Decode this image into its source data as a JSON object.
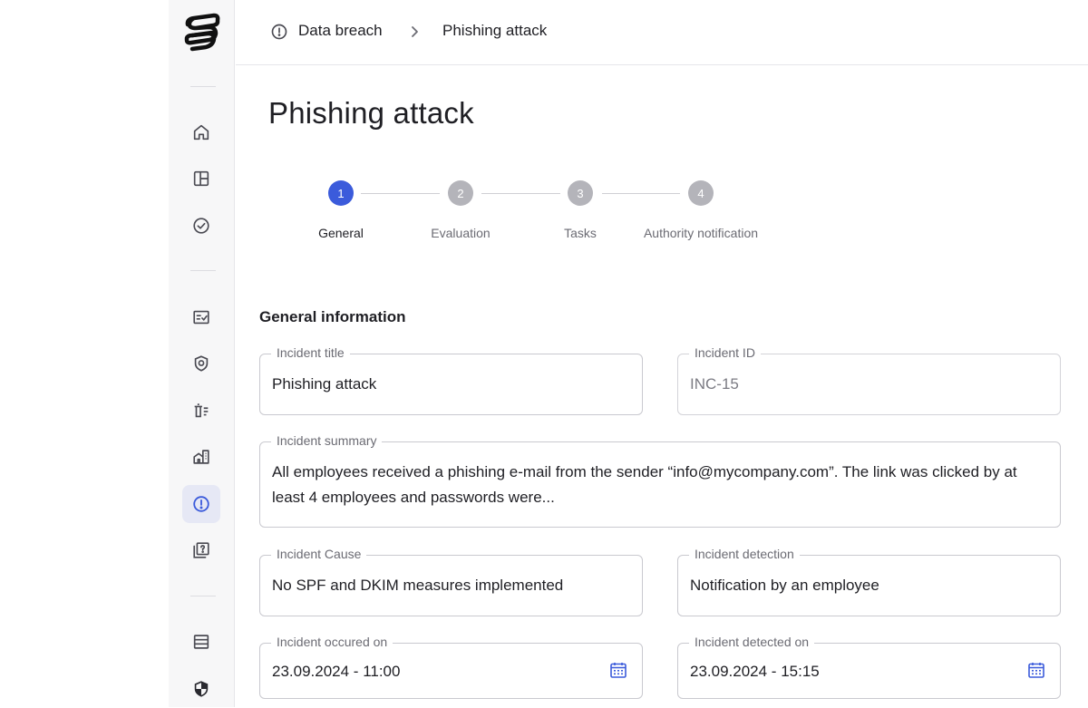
{
  "breadcrumb": {
    "items": [
      {
        "label": "Data breach",
        "icon": "alert-circle-icon"
      },
      {
        "label": "Phishing attack"
      }
    ]
  },
  "page": {
    "title": "Phishing attack"
  },
  "stepper": {
    "steps": [
      {
        "number": "1",
        "label": "General",
        "active": true
      },
      {
        "number": "2",
        "label": "Evaluation",
        "active": false
      },
      {
        "number": "3",
        "label": "Tasks",
        "active": false
      },
      {
        "number": "4",
        "label": "Authority notification",
        "active": false
      }
    ]
  },
  "form": {
    "section_title": "General information",
    "incident_title": {
      "label": "Incident title",
      "value": "Phishing attack"
    },
    "incident_id": {
      "label": "Incident ID",
      "value": "INC-15"
    },
    "incident_summary": {
      "label": "Incident summary",
      "value_line1": "All employees received a phishing e-mail from the sender “info@mycompany.com”. The link was clicked by at",
      "value_line2": "least 4 employees and passwords were..."
    },
    "incident_cause": {
      "label": "Incident Cause",
      "value": "No SPF and DKIM measures implemented"
    },
    "incident_detection": {
      "label": "Incident detection",
      "value": "Notification by an employee"
    },
    "occurred_on": {
      "label": "Incident occured on",
      "value": "23.09.2024 - 11:00"
    },
    "detected_on": {
      "label": "Incident detected on",
      "value": "23.09.2024 - 15:15"
    }
  },
  "sidebar": {
    "icons": [
      "home-icon",
      "layout-icon",
      "check-circle-icon",
      "checklist-icon",
      "shield-user-icon",
      "delete-list-icon",
      "buildings-icon",
      "alert-circle-icon",
      "help-book-icon",
      "storage-icon",
      "shield-icon"
    ],
    "active": "alert-circle-icon"
  },
  "colors": {
    "accent": "#3b5bdb",
    "inactive_step": "#b4b4ba",
    "calendar": "#3b5bdb"
  }
}
